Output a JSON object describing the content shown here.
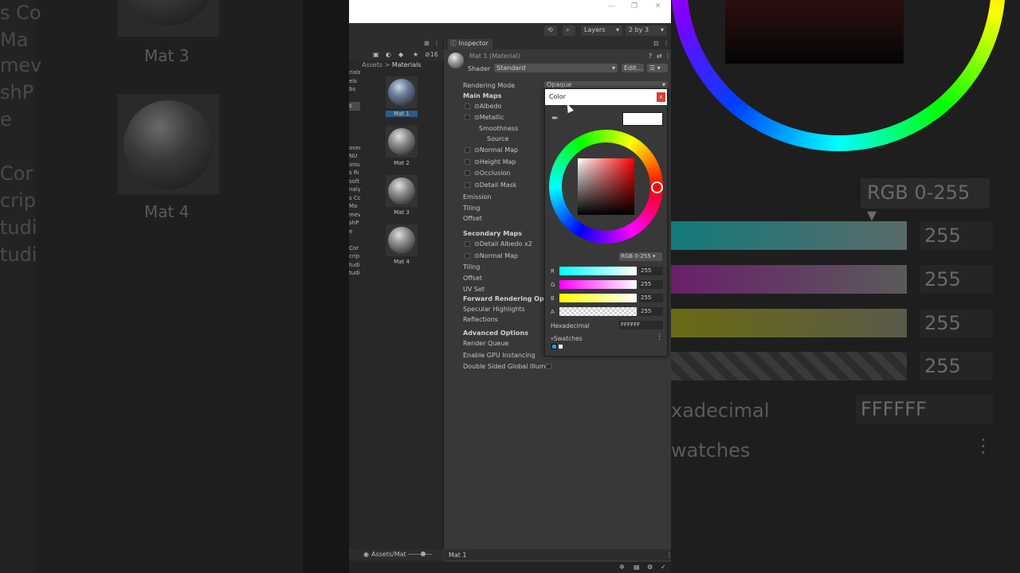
{
  "background_left": {
    "lines": [
      "s Co",
      "Ma",
      "mev",
      "shP",
      "e",
      "",
      "Cor",
      "crip",
      "tudi",
      "tudi"
    ],
    "thumb_labels": [
      "Mat 3",
      "Mat 4"
    ]
  },
  "background_right": {
    "mode_label": "RGB 0-255",
    "values": [
      "255",
      "255",
      "255",
      "255"
    ],
    "hex_label": "xadecimal",
    "hex_value": "FFFFFF",
    "swatches_label": "watches"
  },
  "window": {
    "min": "—",
    "max": "❐",
    "close": "✕"
  },
  "toolbar": {
    "layers": "Layers",
    "layout": "2 by 3"
  },
  "project": {
    "hidden_count": "16",
    "breadcrumb_root": "Assets",
    "breadcrumb_sep": ">",
    "breadcrumb_current": "Materials",
    "tree": [
      "rials",
      "els",
      "bs",
      "",
      "s",
      "",
      "",
      "",
      "",
      "over",
      "NU",
      "orou",
      "s Ri",
      "soft",
      "naly",
      "s Co",
      "Ma",
      "mev",
      "shP",
      "e",
      "",
      "Cor",
      "crip",
      "tudi",
      "tudi"
    ],
    "materials": [
      "Mat 1",
      "Mat 2",
      "Mat 3",
      "Mat 4"
    ],
    "footer_path": "Assets/Mat"
  },
  "inspector": {
    "tab": "Inspector",
    "title": "Mat 1 (Material)",
    "shader_label": "Shader",
    "shader_value": "Standard",
    "edit_label": "Edit...",
    "rendering_mode_label": "Rendering Mode",
    "rendering_mode_value": "Opaque",
    "main_maps": "Main Maps",
    "albedo": "Albedo",
    "metallic": "Metallic",
    "smoothness": "Smoothness",
    "source": "Source",
    "normal_map": "Normal Map",
    "height_map": "Height Map",
    "occlusion": "Occlusion",
    "detail_mask": "Detail Mask",
    "emission": "Emission",
    "tiling": "Tiling",
    "offset": "Offset",
    "secondary_maps": "Secondary Maps",
    "detail_albedo": "Detail Albedo x2",
    "normal_map2": "Normal Map",
    "tiling2": "Tiling",
    "offset2": "Offset",
    "uv_set": "UV Set",
    "forward_rendering": "Forward Rendering Option",
    "specular": "Specular Highlights",
    "reflections": "Reflections",
    "advanced": "Advanced Options",
    "render_queue": "Render Queue",
    "gpu_instancing": "Enable GPU Instancing",
    "double_sided": "Double Sided Global Illumin",
    "footer": "Mat 1"
  },
  "color_picker": {
    "title": "Color",
    "close": "x",
    "current_color": "#ffffff",
    "mode": "RGB 0-255",
    "channels": [
      {
        "label": "R",
        "value": "255"
      },
      {
        "label": "G",
        "value": "255"
      },
      {
        "label": "B",
        "value": "255"
      },
      {
        "label": "A",
        "value": "255"
      }
    ],
    "hex_label": "Hexadecimal",
    "hex_value": "FFFFFF",
    "swatches_label": "Swatches",
    "swatch_colors": [
      "#1ea0e0",
      "#ffffff"
    ]
  }
}
